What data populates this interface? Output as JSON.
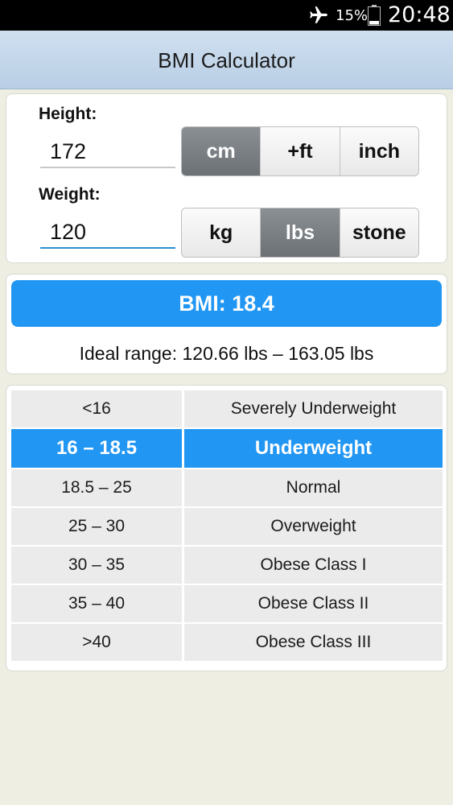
{
  "status_bar": {
    "battery_percent": "15%",
    "time": "20:48",
    "icons": [
      "airplane-mode-icon",
      "battery-icon"
    ]
  },
  "header": {
    "title": "BMI Calculator"
  },
  "height": {
    "label": "Height:",
    "value": "172",
    "units": [
      "cm",
      "+ft",
      "inch"
    ],
    "selected_unit": "cm"
  },
  "weight": {
    "label": "Weight:",
    "value": "120",
    "units": [
      "kg",
      "lbs",
      "stone"
    ],
    "selected_unit": "lbs"
  },
  "result": {
    "bmi_text": "BMI: 18.4",
    "ideal_range": "Ideal range: 120.66 lbs – 163.05 lbs"
  },
  "bmi_table": {
    "rows": [
      {
        "range": "<16",
        "category": "Severely Underweight"
      },
      {
        "range": "16 – 18.5",
        "category": "Underweight"
      },
      {
        "range": "18.5 – 25",
        "category": "Normal"
      },
      {
        "range": "25 – 30",
        "category": "Overweight"
      },
      {
        "range": "30 – 35",
        "category": "Obese Class I"
      },
      {
        "range": "35 – 40",
        "category": "Obese Class II"
      },
      {
        "range": ">40",
        "category": "Obese Class III"
      }
    ],
    "highlighted_index": 1
  },
  "colors": {
    "accent": "#2196f3",
    "header_bg": "#c4d7ea",
    "page_bg": "#eeeee3",
    "segment_active": "#787d82"
  }
}
